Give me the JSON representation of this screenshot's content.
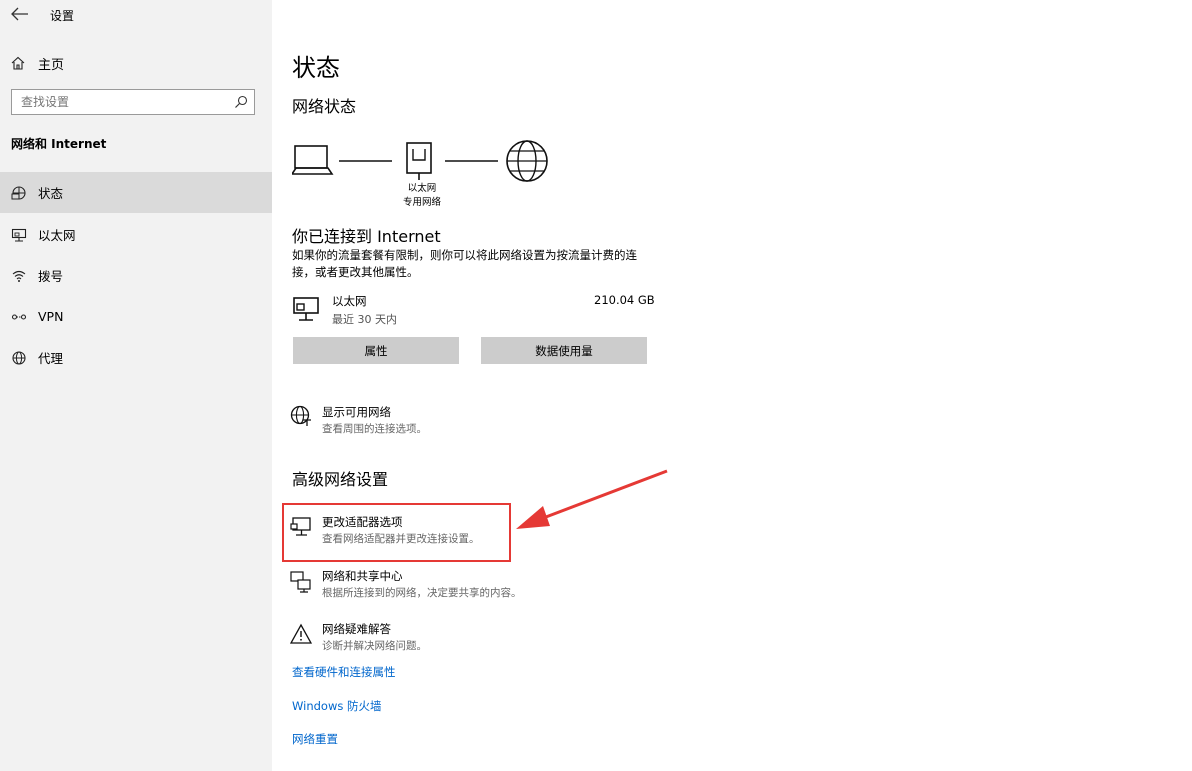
{
  "window": {
    "title": "设置"
  },
  "sidebar": {
    "home_label": "主页",
    "search_placeholder": "查找设置",
    "section_title": "网络和 Internet",
    "items": [
      {
        "label": "状态",
        "icon": "status-icon",
        "active": true
      },
      {
        "label": "以太网",
        "icon": "ethernet-icon",
        "active": false
      },
      {
        "label": "拨号",
        "icon": "dialup-icon",
        "active": false
      },
      {
        "label": "VPN",
        "icon": "vpn-icon",
        "active": false
      },
      {
        "label": "代理",
        "icon": "globe-icon",
        "active": false
      }
    ]
  },
  "main": {
    "page_title": "状态",
    "network_status_heading": "网络状态",
    "diagram": {
      "label_line1": "以太网",
      "label_line2": "专用网络"
    },
    "connected_title": "你已连接到 Internet",
    "connected_desc": "如果你的流量套餐有限制，则你可以将此网络设置为按流量计费的连接，或者更改其他属性。",
    "ethernet": {
      "name": "以太网",
      "period": "最近 30 天内",
      "usage": "210.04 GB"
    },
    "buttons": {
      "properties": "属性",
      "data_usage": "数据使用量"
    },
    "show_networks": {
      "title": "显示可用网络",
      "desc": "查看周围的连接选项。"
    },
    "advanced_heading": "高级网络设置",
    "adapter_options": {
      "title": "更改适配器选项",
      "desc": "查看网络适配器并更改连接设置。"
    },
    "sharing_center": {
      "title": "网络和共享中心",
      "desc": "根据所连接到的网络，决定要共享的内容。"
    },
    "troubleshooter": {
      "title": "网络疑难解答",
      "desc": "诊断并解决网络问题。"
    },
    "links": {
      "hardware": "查看硬件和连接属性",
      "firewall": "Windows 防火墙",
      "reset": "网络重置"
    }
  },
  "colors": {
    "link": "#0066cc",
    "annotation": "#e53935",
    "sidebar_bg": "#f2f2f2",
    "active_bg": "#dadada",
    "button_bg": "#cccccc"
  }
}
